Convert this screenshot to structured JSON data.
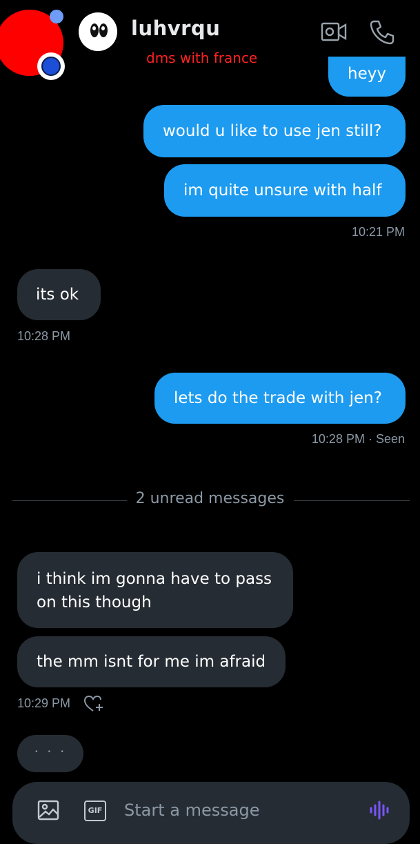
{
  "header": {
    "username": "luhvrqu",
    "annotation": "dms with france",
    "icons": [
      "video-camera-icon",
      "phone-icon"
    ]
  },
  "messages": [
    {
      "direction": "out",
      "text": "heyy"
    },
    {
      "direction": "out",
      "text": "would u like to use jen still?"
    },
    {
      "direction": "out",
      "text": "im quite unsure with half"
    },
    {
      "direction": "in",
      "text": "its ok"
    },
    {
      "direction": "out",
      "text": "lets do the trade with jen?"
    },
    {
      "direction": "in",
      "text": "i think im gonna have to pass on this though"
    },
    {
      "direction": "in",
      "text": "the mm isnt for me im afraid"
    }
  ],
  "timestamps": {
    "t1": "10:21 PM",
    "t2": "10:28 PM",
    "t3": "10:28 PM · Seen",
    "t4": "10:29 PM"
  },
  "divider": "2 unread messages",
  "typing_indicator": "· · ·",
  "composer": {
    "placeholder": "Start a message",
    "gif_label": "GIF"
  },
  "colors": {
    "outgoing_bubble": "#1d9bf0",
    "incoming_bubble": "#262c33",
    "background": "#000000",
    "mic_icon": "#7856ff",
    "annotation": "#ff2020"
  }
}
